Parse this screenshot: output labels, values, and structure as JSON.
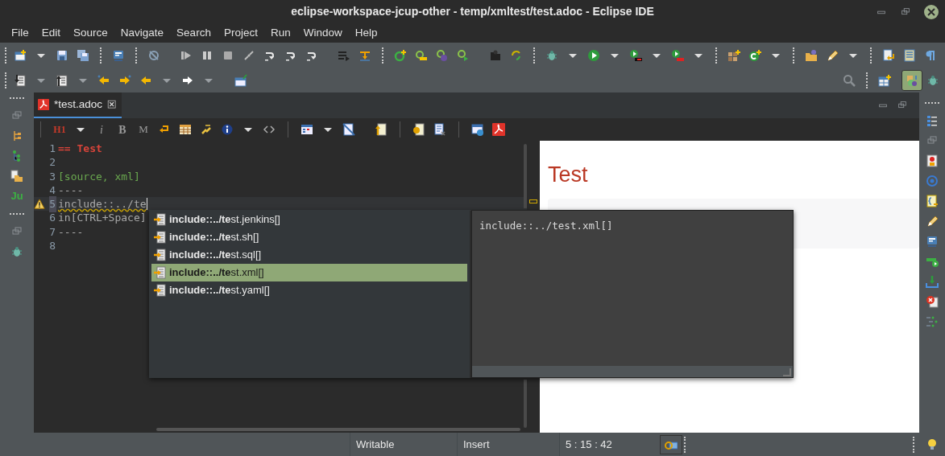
{
  "window": {
    "title": "eclipse-workspace-jcup-other - temp/xmltest/test.adoc - Eclipse IDE"
  },
  "menu": [
    "File",
    "Edit",
    "Source",
    "Navigate",
    "Search",
    "Project",
    "Run",
    "Window",
    "Help"
  ],
  "left_trim": {
    "label": "Ju"
  },
  "editor_tab": {
    "label": "*test.adoc",
    "selected": true
  },
  "format_buttons": [
    {
      "label": "H1",
      "kind": "heading"
    },
    {
      "label": "i",
      "kind": "italic"
    },
    {
      "label": "B",
      "kind": "bold"
    },
    {
      "label": "M",
      "kind": "mono"
    }
  ],
  "lines": [
    {
      "number": "1",
      "text": "== Test",
      "kind": "heading",
      "warning": false,
      "current": false
    },
    {
      "number": "2",
      "warning": false,
      "current": false
    },
    {
      "number": "3",
      "text": "[source, xml]",
      "kind": "attribute",
      "warning": false,
      "current": false
    },
    {
      "number": "4",
      "text": "----",
      "kind": "plain",
      "warning": false,
      "current": false
    },
    {
      "number": "5",
      "text": "include::../te",
      "kind": "plain",
      "warning": true,
      "current": true
    },
    {
      "number": "6",
      "text": "in[CTRL+Space]",
      "kind": "plain",
      "warning": false,
      "current": false
    },
    {
      "number": "7",
      "text": "----",
      "kind": "plain",
      "warning": false,
      "current": false
    },
    {
      "number": "8",
      "warning": false,
      "current": false
    }
  ],
  "completion": {
    "items": [
      {
        "text": "**include::../te**st.jenkins[]",
        "selected": false
      },
      {
        "text": "**include::../te**st.sh[]",
        "selected": false
      },
      {
        "text": "**include::../te**st.sql[]",
        "selected": false
      },
      {
        "text": "**include::../te**st.xml[]",
        "selected": true
      },
      {
        "text": "**include::../te**st.yaml[]",
        "selected": false
      }
    ],
    "detail": "include::../test.xml[]"
  },
  "preview": {
    "heading": "Test"
  },
  "status_bar": [
    "Writable",
    "Insert",
    "5 : 15 : 42"
  ]
}
